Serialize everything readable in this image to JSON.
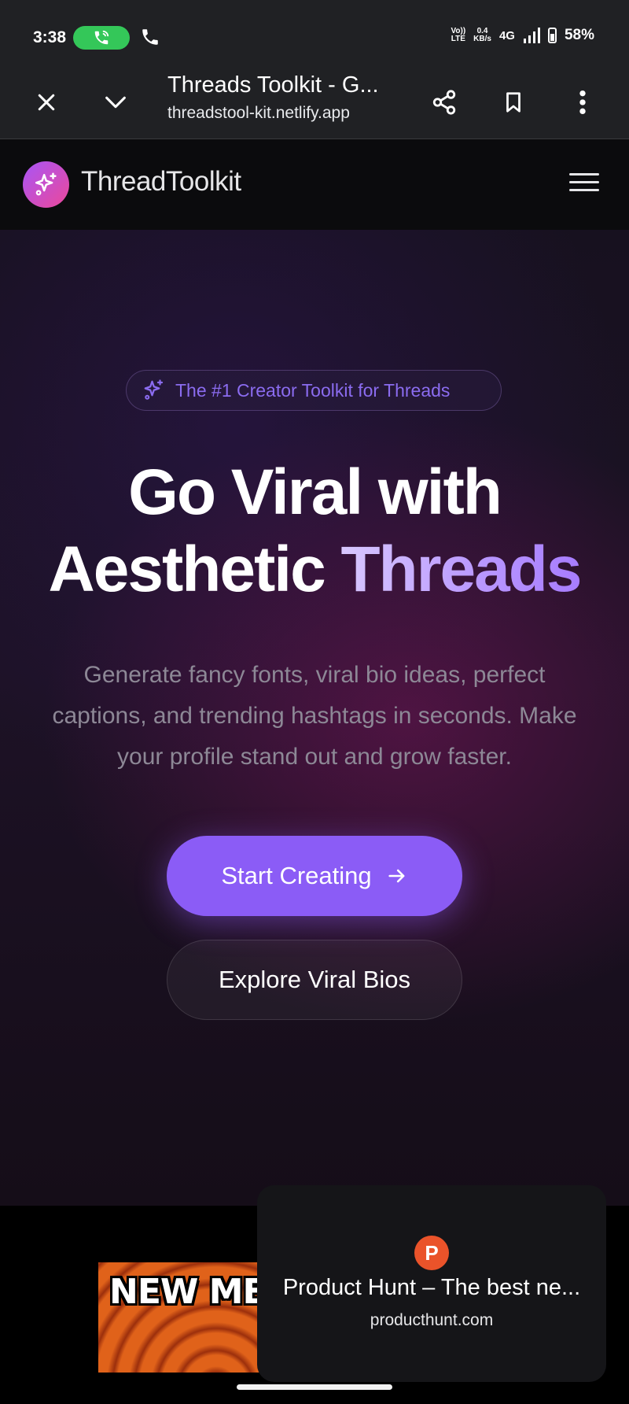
{
  "status_bar": {
    "time": "3:38",
    "net_speed_value": "0.4",
    "net_speed_unit": "KB/s",
    "volte_line1": "Vo))",
    "volte_line2": "LTE",
    "network": "4G",
    "battery": "58%",
    "call_pill_color": "#34c759"
  },
  "browser": {
    "tab_title": "Threads Toolkit - G...",
    "url": "threadstool-kit.netlify.app",
    "icons": [
      "close-icon",
      "chevron-down-icon",
      "share-icon",
      "bookmark-icon",
      "more-vert-icon"
    ]
  },
  "site": {
    "brand": "ThreadToolkit",
    "brand_gradient": [
      "#a855f7",
      "#ec4899"
    ],
    "menu_icon": "hamburger-menu-icon"
  },
  "hero": {
    "badge": "The #1 Creator Toolkit for Threads",
    "title_line1": "Go Viral with",
    "title_line2_plain": "Aesthetic ",
    "title_line2_highlight": "Threads",
    "subtitle": "Generate fancy fonts, viral bio ideas, perfect captions, and trending hashtags in seconds. Make your profile stand out and grow faster.",
    "primary_cta": "Start Creating",
    "secondary_cta": "Explore Viral Bios",
    "accent_color": "#8b5cf6"
  },
  "promo": {
    "image_text": "NEW MEM"
  },
  "product_hunt_card": {
    "logo_letter": "P",
    "title": "Product Hunt – The best ne...",
    "domain": "producthunt.com",
    "logo_color": "#ea532a"
  }
}
